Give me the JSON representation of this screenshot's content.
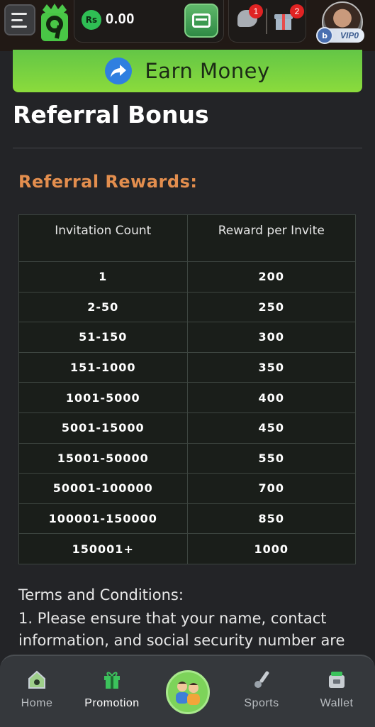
{
  "header": {
    "balance": "0.00",
    "currency_symbol": "Rs",
    "chat_badge": "1",
    "gift_badge": "2",
    "vip_label": "VIP0"
  },
  "banner": {
    "label": "Earn Money"
  },
  "page": {
    "title": "Referral Bonus",
    "section_title": "Referral Rewards:"
  },
  "table": {
    "headers": [
      "Invitation Count",
      "Reward per Invite"
    ],
    "rows": [
      [
        "1",
        "200"
      ],
      [
        "2-50",
        "250"
      ],
      [
        "51-150",
        "300"
      ],
      [
        "151-1000",
        "350"
      ],
      [
        "1001-5000",
        "400"
      ],
      [
        "5001-15000",
        "450"
      ],
      [
        "15001-50000",
        "550"
      ],
      [
        "50001-100000",
        "700"
      ],
      [
        "100001-150000",
        "850"
      ],
      [
        "150001+",
        "1000"
      ]
    ]
  },
  "terms": {
    "title": "Terms and Conditions:",
    "line1": "1. Please ensure that your name, contact information, and social security number are"
  },
  "nav": {
    "home": "Home",
    "promotion": "Promotion",
    "sports": "Sports",
    "wallet": "Wallet"
  },
  "colors": {
    "accent_green": "#6cc94a",
    "section_orange": "#e38e4e",
    "badge_red": "#e02323"
  }
}
